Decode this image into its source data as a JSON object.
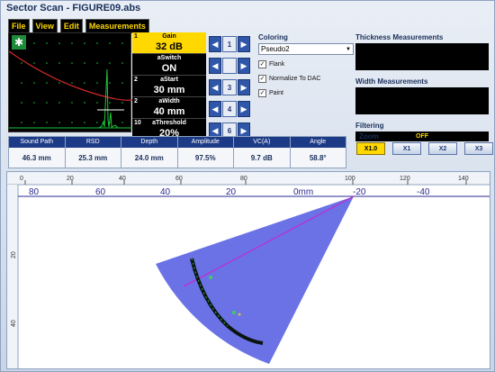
{
  "window": {
    "title": "Sector Scan - FIGURE09.abs"
  },
  "menu": [
    "File",
    "View",
    "Edit",
    "Measurements"
  ],
  "params": [
    {
      "num": "1",
      "name": "Gain",
      "value": "32 dB"
    },
    {
      "num": "",
      "name": "aSwitch",
      "value": "ON"
    },
    {
      "num": "2",
      "name": "aStart",
      "value": "30 mm"
    },
    {
      "num": "2",
      "name": "aWidth",
      "value": "40 mm"
    },
    {
      "num": "10",
      "name": "aThreshold",
      "value": "20%"
    }
  ],
  "steps": [
    "1",
    "",
    "3",
    "4",
    "6"
  ],
  "coloring": {
    "title": "Coloring",
    "selected": "Pseudo2",
    "checkboxes": [
      {
        "label": "Flank",
        "checked": true
      },
      {
        "label": "Normalize To DAC",
        "checked": true
      },
      {
        "label": "Paint",
        "checked": true
      }
    ]
  },
  "thickness": {
    "title": "Thickness Measurements"
  },
  "width": {
    "title": "Width Measurements"
  },
  "filtering": {
    "title": "Filtering",
    "value": "OFF"
  },
  "zoom": {
    "title": "Zoom",
    "buttons": [
      "X1.0",
      "X1",
      "X2",
      "X3"
    ],
    "active": 0
  },
  "measurements": [
    {
      "label": "Sound Path",
      "value": "46.3 mm"
    },
    {
      "label": "RSD",
      "value": "25.3 mm"
    },
    {
      "label": "Depth",
      "value": "24.0 mm"
    },
    {
      "label": "Amplitude",
      "value": "97.5%"
    },
    {
      "label": "VC(A)",
      "value": "9.7 dB"
    },
    {
      "label": "Angle",
      "value": "58.8°"
    }
  ],
  "scan": {
    "top_ruler_ticks": [
      "0",
      "20",
      "40",
      "60",
      "80",
      "100",
      "120",
      "140"
    ],
    "position_labels": [
      "80",
      "60",
      "40",
      "20",
      "0mm",
      "-20",
      "-40"
    ],
    "left_ruler_ticks": [
      "20",
      "40"
    ],
    "colors": {
      "sector": "#6a72e6",
      "reflector": "#0a1410",
      "beam_line": "#d21ec8"
    }
  }
}
